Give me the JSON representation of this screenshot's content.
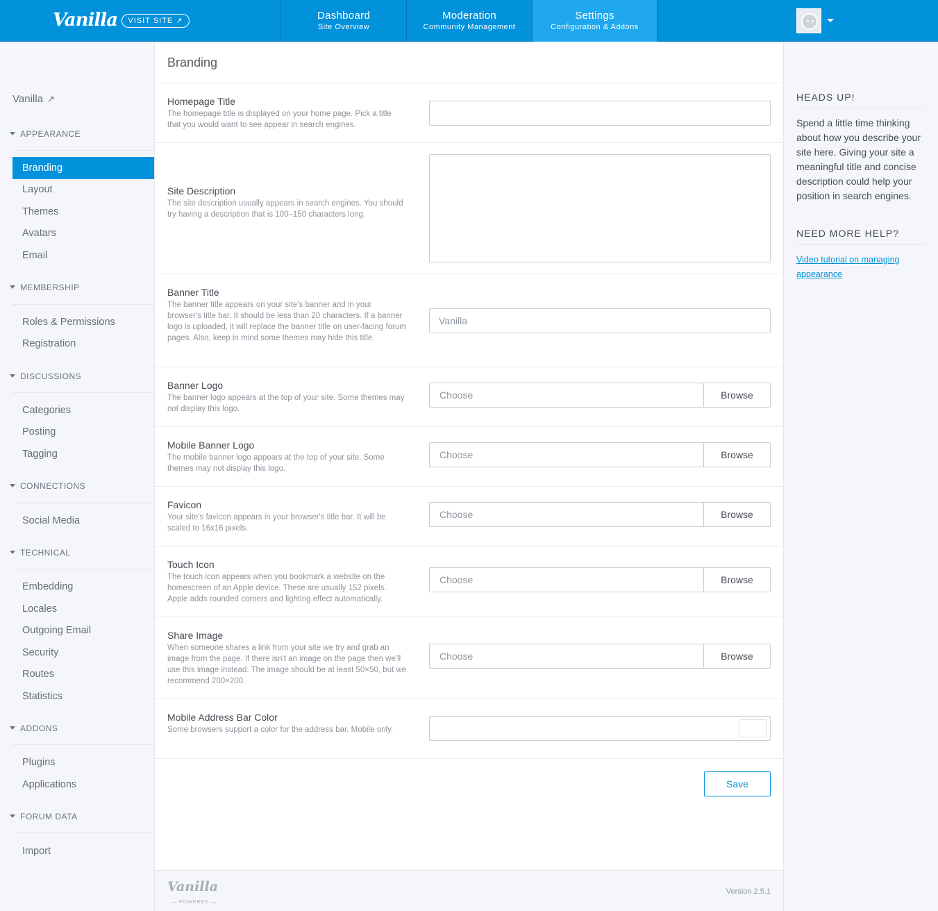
{
  "navbar": {
    "logo": "Vanilla",
    "visit_site": "VISIT SITE ↗",
    "tabs": [
      {
        "title": "Dashboard",
        "subtitle": "Site Overview"
      },
      {
        "title": "Moderation",
        "subtitle": "Community Management"
      },
      {
        "title": "Settings",
        "subtitle": "Configuration & Addons"
      }
    ]
  },
  "sidebar": {
    "home": "Vanilla",
    "sections": [
      {
        "title": "APPEARANCE",
        "items": [
          "Branding",
          "Layout",
          "Themes",
          "Avatars",
          "Email"
        ]
      },
      {
        "title": "MEMBERSHIP",
        "items": [
          "Roles & Permissions",
          "Registration"
        ]
      },
      {
        "title": "DISCUSSIONS",
        "items": [
          "Categories",
          "Posting",
          "Tagging"
        ]
      },
      {
        "title": "CONNECTIONS",
        "items": [
          "Social Media"
        ]
      },
      {
        "title": "TECHNICAL",
        "items": [
          "Embedding",
          "Locales",
          "Outgoing Email",
          "Security",
          "Routes",
          "Statistics"
        ]
      },
      {
        "title": "ADDONS",
        "items": [
          "Plugins",
          "Applications"
        ]
      },
      {
        "title": "FORUM DATA",
        "items": [
          "Import"
        ]
      }
    ]
  },
  "main": {
    "title": "Branding",
    "fields": {
      "homepage_title": {
        "label": "Homepage Title",
        "desc": "The homepage title is displayed on your home page. Pick a title that you would want to see appear in search engines.",
        "value": ""
      },
      "site_description": {
        "label": "Site Description",
        "desc": "The site description usually appears in search engines. You should try having a description that is 100–150 characters long.",
        "value": ""
      },
      "banner_title": {
        "label": "Banner Title",
        "desc": "The banner title appears on your site's banner and in your browser's title bar. It should be less than 20 characters. If a banner logo is uploaded, it will replace the banner title on user-facing forum pages. Also, keep in mind some themes may hide this title.",
        "value": "Vanilla"
      },
      "banner_logo": {
        "label": "Banner Logo",
        "desc": "The banner logo appears at the top of your site. Some themes may not display this logo."
      },
      "mobile_banner_logo": {
        "label": "Mobile Banner Logo",
        "desc": "The mobile banner logo appears at the top of your site. Some themes may not display this logo."
      },
      "favicon": {
        "label": "Favicon",
        "desc": "Your site's favicon appears in your browser's title bar. It will be scaled to 16x16 pixels."
      },
      "touch_icon": {
        "label": "Touch Icon",
        "desc": "The touch icon appears when you bookmark a website on the homescreen of an Apple device. These are usually 152 pixels. Apple adds rounded corners and lighting effect automatically."
      },
      "share_image": {
        "label": "Share Image",
        "desc": "When someone shares a link from your site we try and grab an image from the page. If there isn't an image on the page then we'll use this image instead. The image should be at least 50×50, but we recommend 200×200."
      },
      "mobile_address_bar_color": {
        "label": "Mobile Address Bar Color",
        "desc": "Some browsers support a color for the address bar. Mobile only.",
        "value": "",
        "swatch": "#ffffff"
      }
    },
    "file_choose": "Choose",
    "file_browse": "Browse",
    "save": "Save",
    "footer": {
      "logo": "Vanilla",
      "powered": "— POWERED —",
      "version": "Version 2.5.1"
    }
  },
  "help": {
    "heads_up_title": "HEADS UP!",
    "heads_up_text": "Spend a little time thinking about how you describe your site here. Giving your site a meaningful title and concise description could help your position in search engines.",
    "more_help_title": "NEED MORE HELP?",
    "link": "Video tutorial on managing appearance"
  },
  "colors": {
    "brand": "#0291db",
    "active_tab": "#1fa8ef"
  }
}
